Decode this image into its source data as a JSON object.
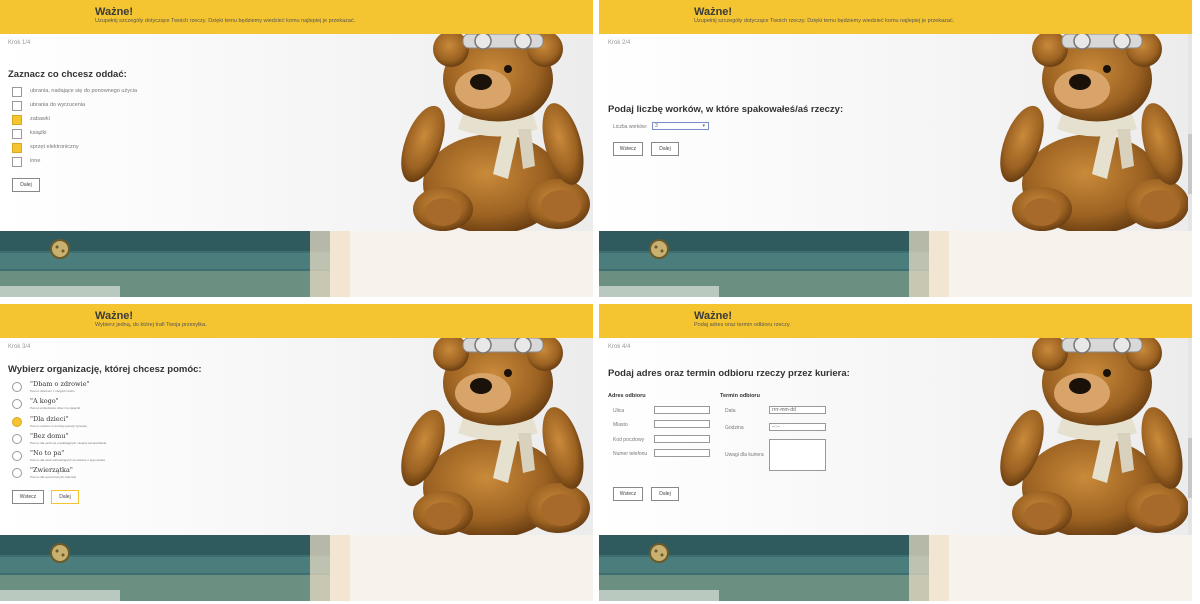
{
  "banner": {
    "title": "Ważne!",
    "sub1": "Uzupełnij szczegóły dotyczące Twoich rzeczy. Dzięki temu będziemy wiedzieć komu najlepiej je przekazać.",
    "sub2": "Uzupełnij szczegóły dotyczące Twoich rzeczy. Dzięki temu będziemy wiedzieć komu najlepiej je przekazać.",
    "sub3": "Wybierz jedną, do której trafi Twoja przesyłka.",
    "sub4": "Podaj adres oraz termin odbioru rzeczy."
  },
  "step1": {
    "step": "Krok 1/4",
    "heading": "Zaznacz co chcesz oddać:",
    "options": [
      {
        "label": "ubrania, nadające się do ponownego użycia",
        "checked": false
      },
      {
        "label": "ubrania do wyrzucenia",
        "checked": false
      },
      {
        "label": "zabawki",
        "checked": true
      },
      {
        "label": "książki",
        "checked": false
      },
      {
        "label": "sprzęt elektroniczny",
        "checked": true
      },
      {
        "label": "inne",
        "checked": false
      }
    ],
    "next": "Dalej"
  },
  "step2": {
    "step": "Krok 2/4",
    "heading": "Podaj liczbę worków, w które spakowałeś/aś rzeczy:",
    "bags_label": "Liczba worków:",
    "bags_value": "3",
    "back": "Wstecz",
    "next": "Dalej"
  },
  "step3": {
    "step": "Krok 3/4",
    "heading": "Wybierz organizację, której chcesz pomóc:",
    "orgs": [
      {
        "name": "\"Dbam o zdrowie\"",
        "desc": "Pomoc dzieciom z ubogich rodzin",
        "selected": false
      },
      {
        "name": "\"A kogo\"",
        "desc": "Pomoc wybudzaniu dzieci ze śpiączki",
        "selected": false
      },
      {
        "name": "\"Dla dzieci\"",
        "desc": "Pomoc osobom w trudnej sytuacji życiowej",
        "selected": true
      },
      {
        "name": "\"Bez domu\"",
        "desc": "Pomoc dla osób nie posiadających miejsca zamieszkania",
        "selected": false
      },
      {
        "name": "\"No to pa\"",
        "desc": "Pomoc dla osób odchodzących na zawsze z tego świata",
        "selected": false
      },
      {
        "name": "\"Zwierzątka\"",
        "desc": "Pomoc dla opuszczonych zwierząt",
        "selected": false
      }
    ],
    "back": "Wstecz",
    "next": "Dalej"
  },
  "step4": {
    "step": "Krok 4/4",
    "heading": "Podaj adres oraz termin odbioru rzeczy przez kuriera:",
    "address_title": "Adres odbioru",
    "street": "Ulica",
    "city": "Miasto",
    "postcode": "Kod pocztowy",
    "phone": "Numer telefonu",
    "term_title": "Termin odbioru",
    "date": "Data",
    "date_placeholder": "rrrr-mm-dd",
    "hour": "Godzina",
    "hour_placeholder": "--:--",
    "notes": "Uwagi dla kuriera",
    "back": "Wstecz",
    "next": "Dalej"
  },
  "colors": {
    "accent": "#f5c531"
  }
}
